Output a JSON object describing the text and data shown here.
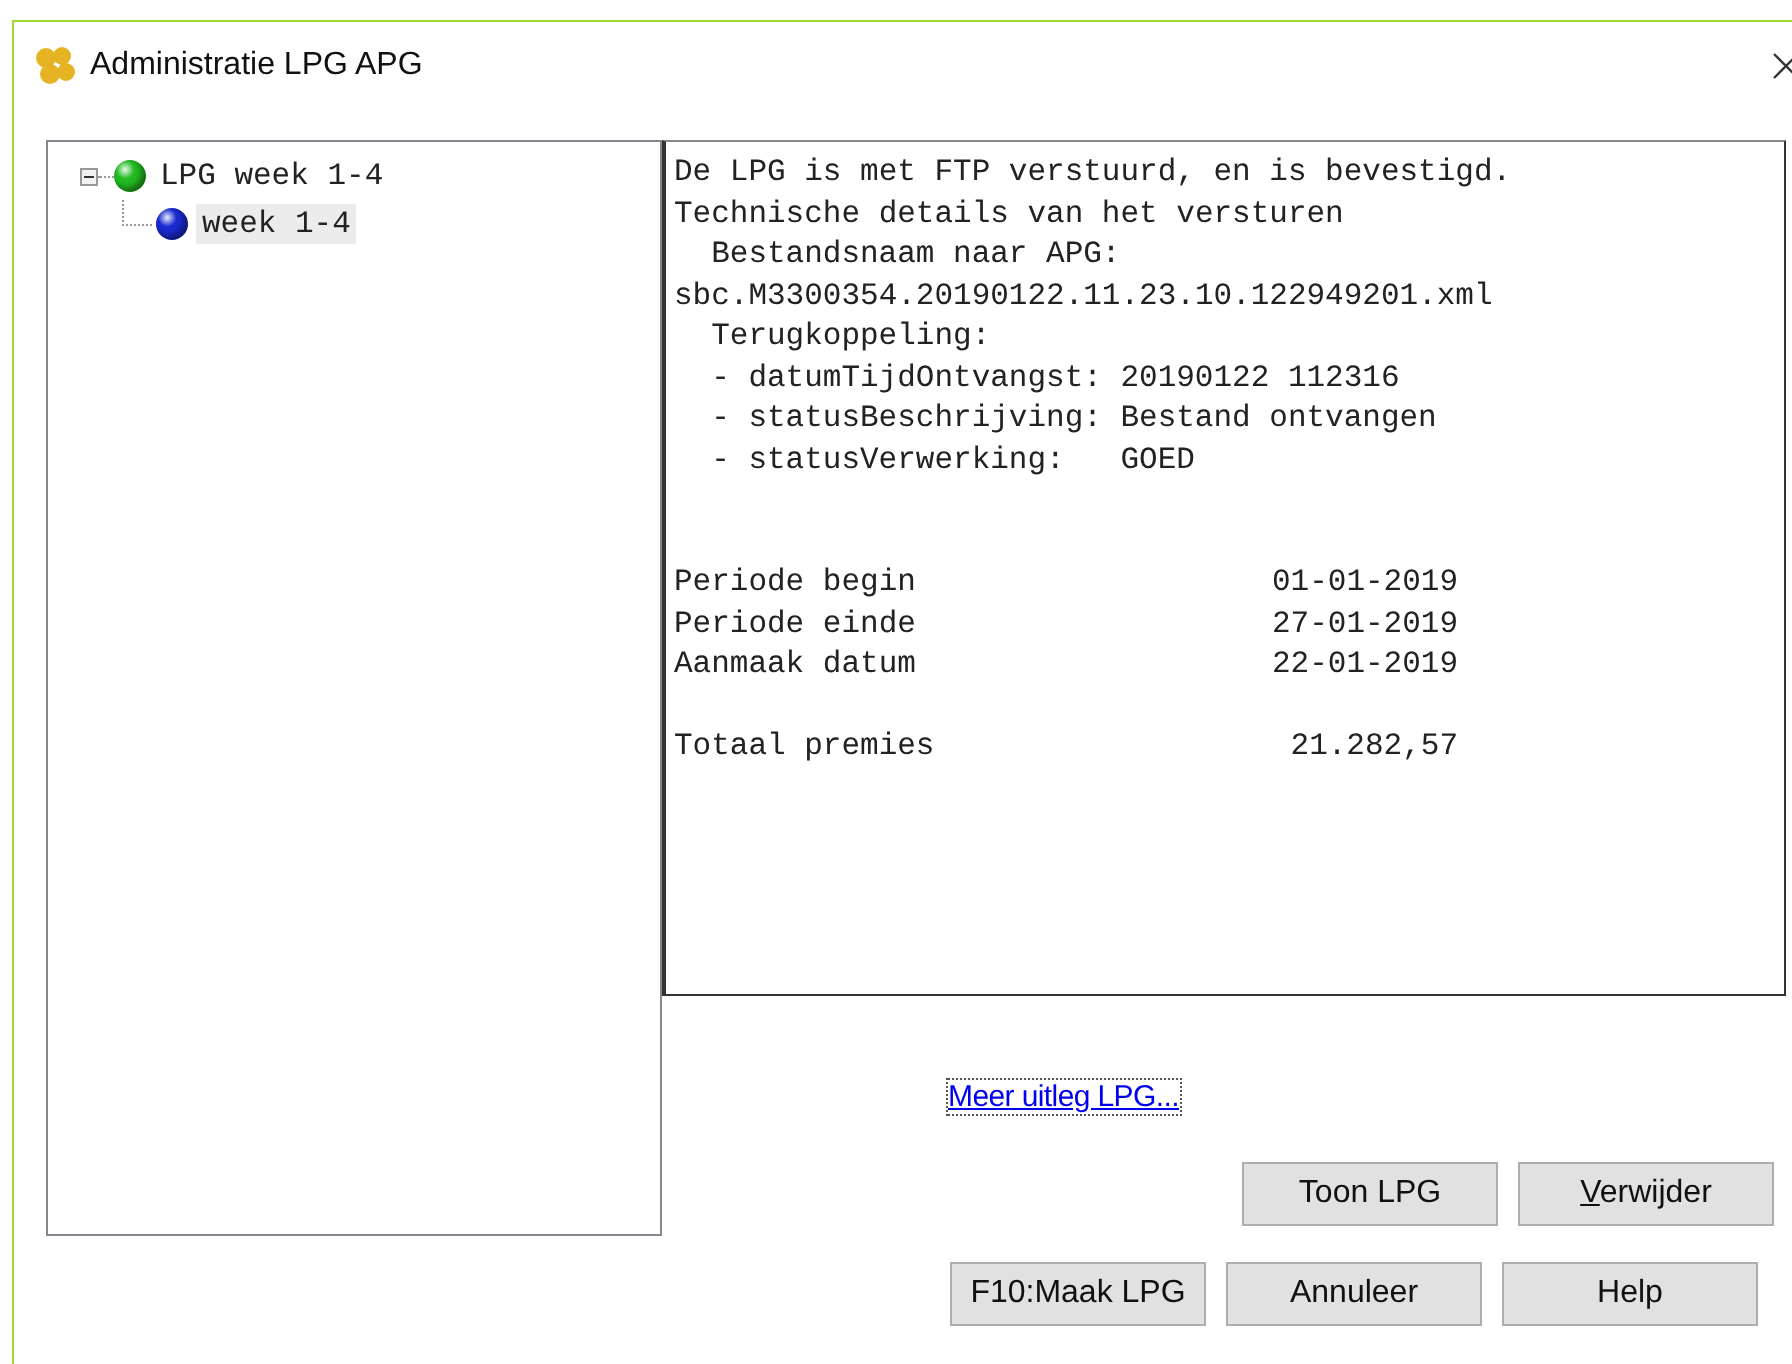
{
  "window": {
    "title": "Administratie LPG APG"
  },
  "tree": [
    {
      "label": "LPG week 1-4",
      "color": "#22bb22",
      "expanded": true,
      "selected": false,
      "children": [
        {
          "label": "week 1-4",
          "color": "#1a2ad0",
          "selected": true
        }
      ]
    }
  ],
  "details": {
    "lines": [
      {
        "kind": "plain",
        "text": "De LPG is met FTP verstuurd, en is bevestigd."
      },
      {
        "kind": "plain",
        "text": "Technische details van het versturen"
      },
      {
        "kind": "indent",
        "text": "Bestandsnaam naar APG:"
      },
      {
        "kind": "plain",
        "text": "sbc.M3300354.20190122.11.23.10.122949201.xml"
      },
      {
        "kind": "indent",
        "text": "Terugkoppeling:"
      },
      {
        "kind": "indent",
        "text": "- datumTijdOntvangst: 20190122 112316"
      },
      {
        "kind": "indent",
        "text": "- statusBeschrijving: Bestand ontvangen"
      },
      {
        "kind": "indent",
        "text": "- statusVerwerking:   GOED"
      }
    ],
    "summary": [
      {
        "label": "Periode begin",
        "value": "01-01-2019"
      },
      {
        "label": "Periode einde",
        "value": "27-01-2019"
      },
      {
        "label": "Aanmaak datum",
        "value": "22-01-2019"
      }
    ],
    "total": {
      "label": "Totaal premies",
      "value": "21.282,57"
    }
  },
  "link": "Meer uitleg LPG...",
  "buttons_row1": [
    {
      "label": "Toon LPG",
      "access_key_underlined": false
    },
    {
      "label": "Verwijder",
      "access_key_underlined": true
    }
  ],
  "buttons_row2": [
    {
      "label": "F10:Maak LPG",
      "access_key_underlined": false
    },
    {
      "label": "Annuleer",
      "access_key_underlined": false
    },
    {
      "label": "Help",
      "access_key_underlined": false
    }
  ]
}
